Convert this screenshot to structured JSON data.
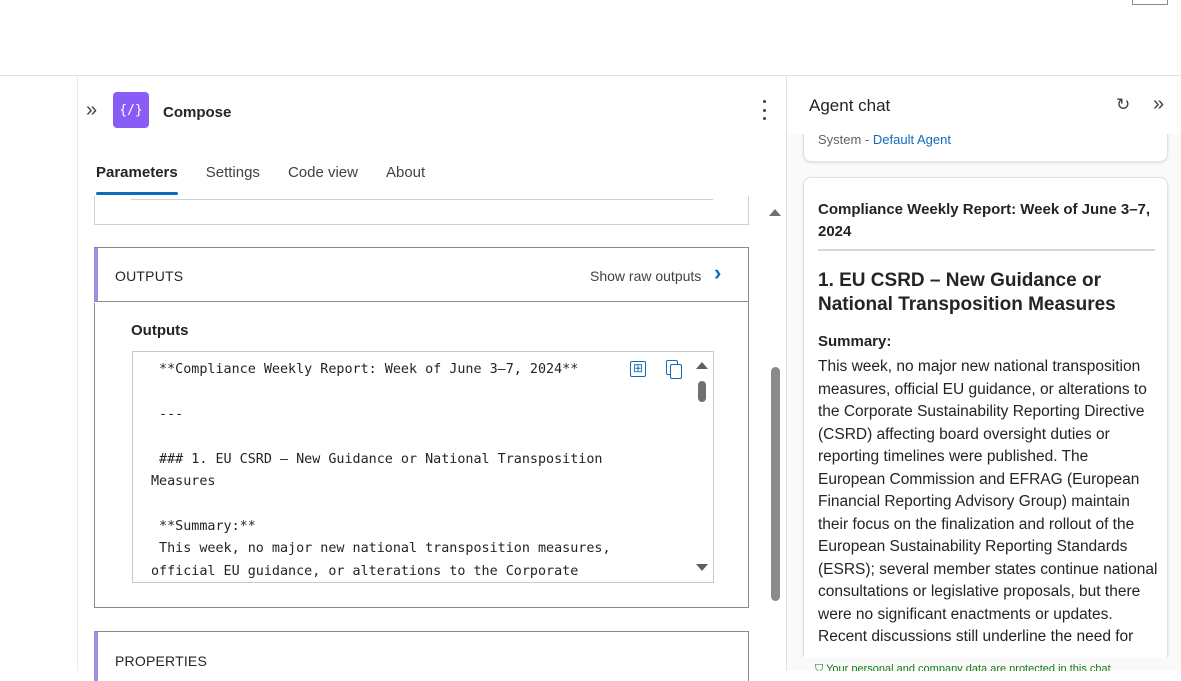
{
  "compose": {
    "title": "Compose",
    "icon_glyph": "{/}",
    "tabs": [
      "Parameters",
      "Settings",
      "Code view",
      "About"
    ],
    "active_tab": "Parameters",
    "outputs_section": {
      "title": "OUTPUTS",
      "show_raw_label": "Show raw outputs",
      "outputs_label": "Outputs",
      "code": " **Compliance Weekly Report: Week of June 3–7, 2024**\n\n ---\n\n ### 1. EU CSRD – New Guidance or National Transposition\nMeasures\n\n **Summary:**\n This week, no major new national transposition measures,\nofficial EU guidance, or alterations to the Corporate"
    },
    "properties_section": {
      "title": "PROPERTIES"
    }
  },
  "chat": {
    "title": "Agent chat",
    "system_prefix": "System - ",
    "system_agent": "Default Agent",
    "message": {
      "heading": "Compliance Weekly Report: Week of June 3–7, 2024",
      "section_title": "1. EU CSRD – New Guidance or National Transposition Measures",
      "summary_label": "Summary:",
      "summary_text": "This week, no major new national transposition measures, official EU guidance, or alterations to the Corporate Sustainability Reporting Directive (CSRD) affecting board oversight duties or reporting timelines were published. The European Commission and EFRAG (European Financial Reporting Advisory Group) maintain their focus on the finalization and rollout of the European Sustainability Reporting Standards (ESRS); several member states continue national consultations or legislative proposals, but there were no significant enactments or updates. Recent discussions still underline the need for"
    },
    "footer": "Your personal and company data are protected in this chat"
  },
  "colors": {
    "accent": "#0f6cbd",
    "compose_icon": "#8a5cf6",
    "section_bar": "#a58ae8"
  }
}
